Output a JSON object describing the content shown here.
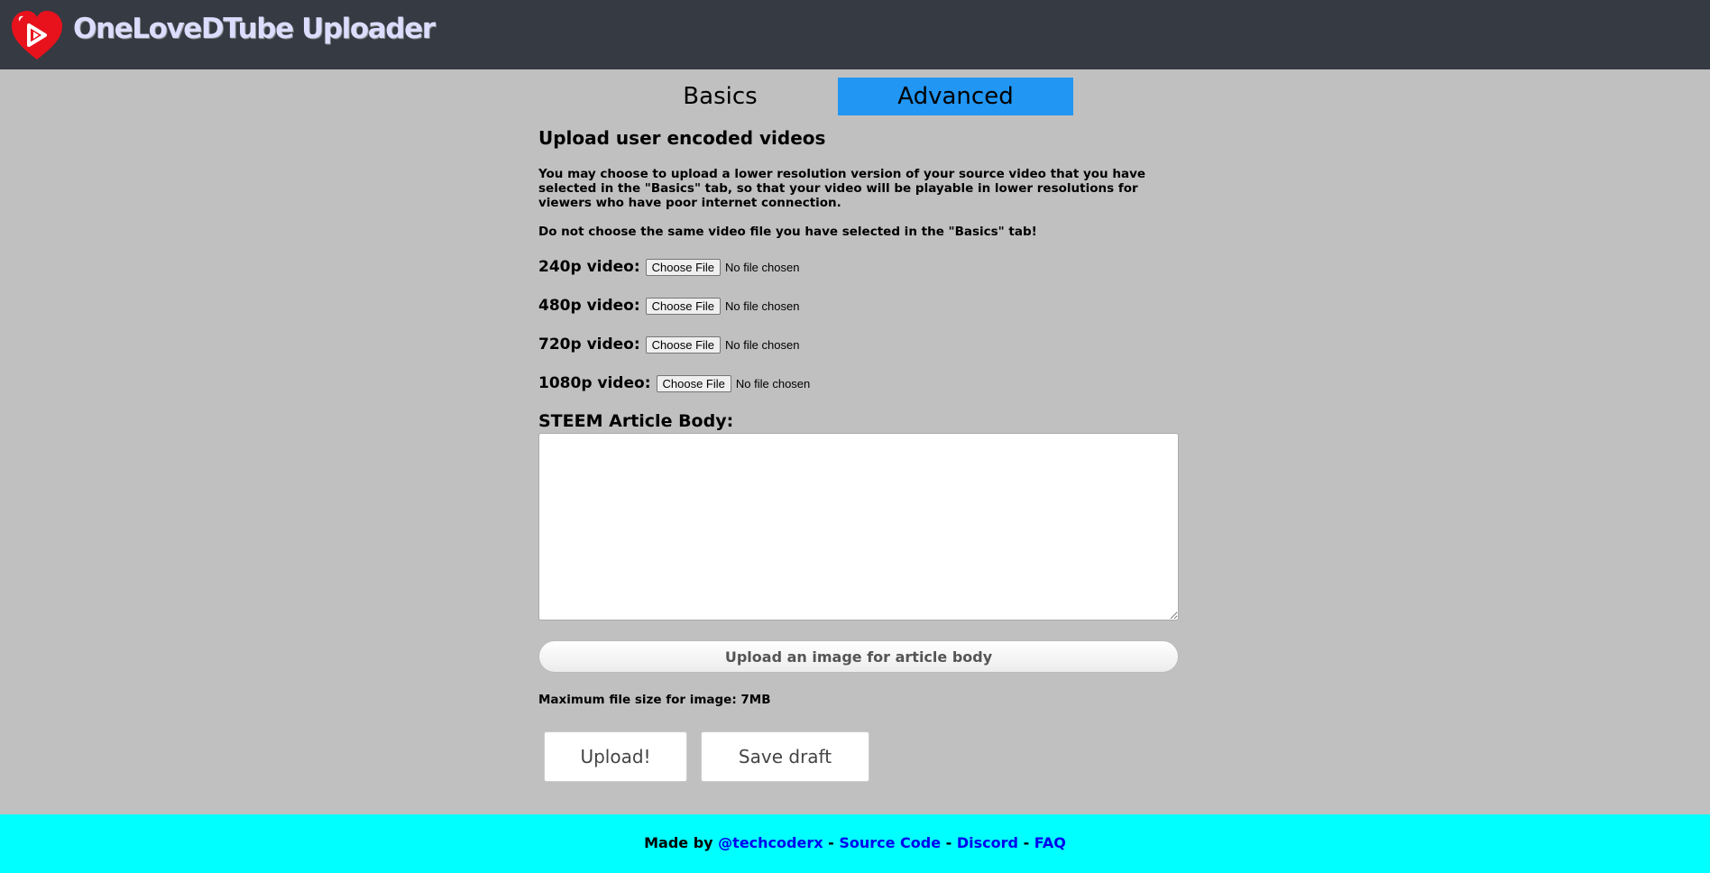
{
  "header": {
    "title": "OneLoveDTube Uploader",
    "logo": "dtube-heart-logo",
    "brand_color": "#e8121d",
    "bar_color": "#363a42"
  },
  "tabs": [
    {
      "label": "Basics",
      "active": false
    },
    {
      "label": "Advanced",
      "active": true,
      "color": "#2196f3"
    }
  ],
  "advanced": {
    "heading": "Upload user encoded videos",
    "description": "You may choose to upload a lower resolution version of your source video that you have selected in the \"Basics\" tab, so that your video will be playable in lower resolutions for viewers who have poor internet connection.",
    "warning": "Do not choose the same video file you have selected in the \"Basics\" tab!",
    "file_inputs": [
      {
        "label": "240p video:",
        "button": "Choose File",
        "status": "No file chosen"
      },
      {
        "label": "480p video:",
        "button": "Choose File",
        "status": "No file chosen"
      },
      {
        "label": "720p video:",
        "button": "Choose File",
        "status": "No file chosen"
      },
      {
        "label": "1080p video:",
        "button": "Choose File",
        "status": "No file chosen"
      }
    ],
    "body_label": "STEEM Article Body:",
    "body_value": "",
    "upload_image_label": "Upload an image for article body",
    "max_size_note": "Maximum file size for image: 7MB",
    "upload_label": "Upload!",
    "save_draft_label": "Save draft"
  },
  "footer": {
    "prefix": "Made by",
    "author": "@techcoderx",
    "source": "Source Code",
    "discord": "Discord",
    "faq": "FAQ",
    "separator": "-",
    "background": "#00ffff"
  }
}
